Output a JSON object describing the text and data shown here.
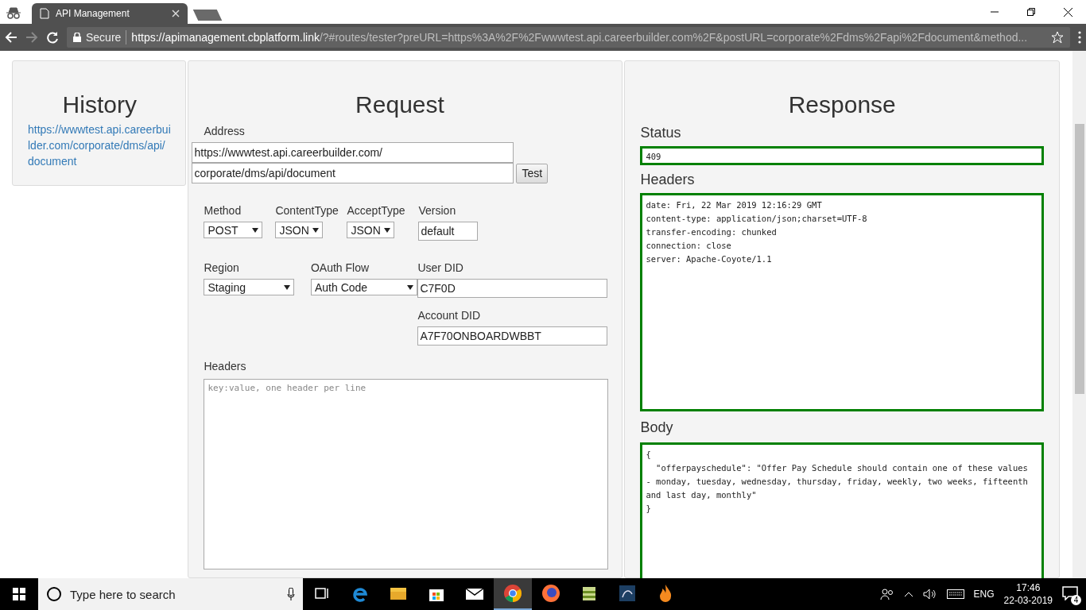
{
  "browser": {
    "tab_title": "API Management",
    "secure_label": "Secure",
    "url_host": "https://apimanagement.cbplatform.link",
    "url_rest": "/?#routes/tester?preURL=https%3A%2F%2Fwwwtest.api.careerbuilder.com%2F&postURL=corporate%2Fdms%2Fapi%2Fdocument&method..."
  },
  "history": {
    "title": "History",
    "items": [
      "https://wwwtest.api.careerbuilder.com/corporate/dms/api/document"
    ]
  },
  "request": {
    "title": "Request",
    "address_label": "Address",
    "address_base": "https://wwwtest.api.careerbuilder.com/",
    "address_path": "corporate/dms/api/document",
    "test_button": "Test",
    "field_rows": [
      [
        [
          {
            "kind": "select",
            "label": "Method",
            "value": "POST"
          }
        ],
        [
          {
            "kind": "select",
            "label": "ContentType",
            "value": "JSON"
          }
        ],
        [
          {
            "kind": "select",
            "label": "AcceptType",
            "value": "JSON"
          }
        ],
        [
          {
            "kind": "text",
            "label": "Version",
            "value": "default"
          }
        ]
      ],
      [
        [
          {
            "kind": "select",
            "label": "Region",
            "value": "Staging"
          }
        ],
        [
          {
            "kind": "select",
            "label": "OAuth Flow",
            "value": "Auth Code"
          }
        ],
        [
          {
            "kind": "text",
            "label": "User DID",
            "value": "C7F0D"
          },
          {
            "kind": "text",
            "label": "Account DID",
            "value": "A7F70ONBOARDWBBT"
          }
        ]
      ]
    ],
    "headers_label": "Headers",
    "headers_placeholder": "key:value, one header per line"
  },
  "response": {
    "title": "Response",
    "status_label": "Status",
    "status_value": "409",
    "headers_label": "Headers",
    "headers_lines": [
      "date: Fri, 22 Mar 2019 12:16:29 GMT",
      "content-type: application/json;charset=UTF-8",
      "transfer-encoding: chunked",
      "connection: close",
      "server: Apache-Coyote/1.1"
    ],
    "body_label": "Body",
    "body_lines": [
      "{",
      "  \"offerpayschedule\": \"Offer Pay Schedule should contain one of these values",
      "- monday, tuesday, wednesday, thursday, friday, weekly, two weeks, fifteenth",
      "and last day, monthly\"",
      "}"
    ]
  },
  "taskbar": {
    "search_placeholder": "Type here to search",
    "apps": [
      {
        "kind": "taskview",
        "selected": false
      },
      {
        "kind": "edge",
        "selected": false
      },
      {
        "kind": "explorer",
        "selected": false
      },
      {
        "kind": "store",
        "selected": false
      },
      {
        "kind": "mail",
        "selected": false
      },
      {
        "kind": "chrome",
        "selected": true
      },
      {
        "kind": "firefox",
        "selected": false
      },
      {
        "kind": "archive",
        "selected": false
      },
      {
        "kind": "database",
        "selected": false
      },
      {
        "kind": "flame",
        "selected": false
      }
    ],
    "language": "ENG",
    "time": "17:46",
    "date": "22-03-2019",
    "notification_count": "4"
  }
}
